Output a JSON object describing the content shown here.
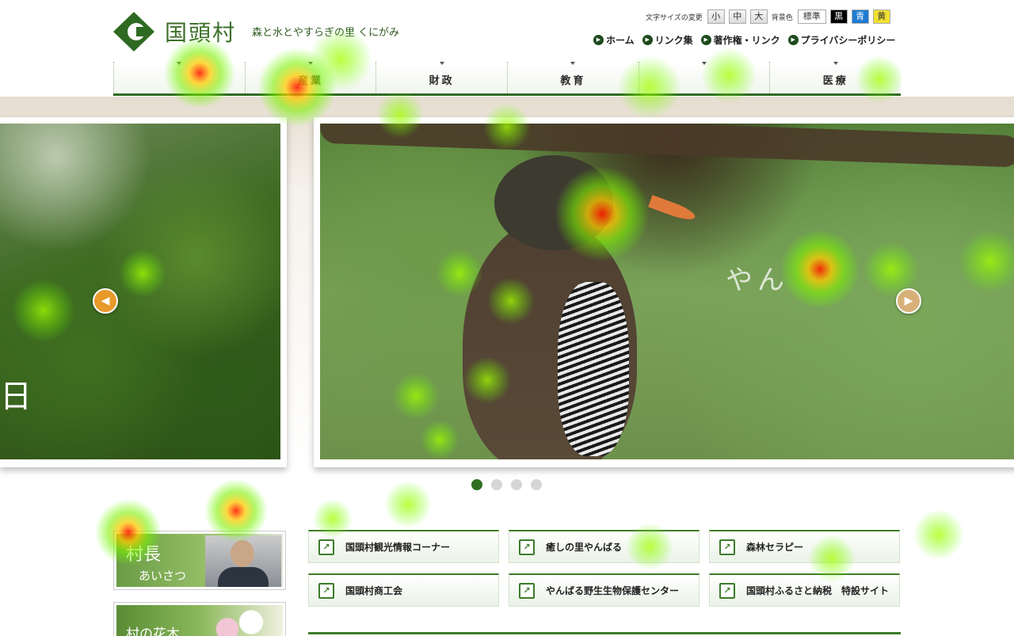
{
  "header": {
    "logo_title": "国頭村",
    "tagline": "森と水とやすらぎの里 くにがみ",
    "font_size_label": "文字サイズの変更",
    "font_sizes": [
      "小",
      "中",
      "大"
    ],
    "bg_color_label": "背景色",
    "bg_colors": [
      "標準",
      "黒",
      "青",
      "黄"
    ],
    "links": [
      "ホーム",
      "リンク集",
      "著作権・リンク",
      "プライバシーポリシー"
    ]
  },
  "global_nav": [
    "",
    "産業",
    "財政",
    "教育",
    "",
    "医療"
  ],
  "slider": {
    "left_caption_1": "日",
    "left_caption_2": "",
    "main_caption": "やん",
    "pages": 4,
    "active_page": 1
  },
  "side_banners": {
    "mayor_title": "村長",
    "mayor_sub": "あいさつ",
    "flower_title": "村の花木"
  },
  "quick_links": [
    "国頭村観光情報コーナー",
    "癒しの里やんばる",
    "森林セラピー",
    "国頭村商工会",
    "やんばる野生生物保護センター",
    "国頭村ふるさと納税　特設サイト"
  ],
  "icons": {
    "logo": "kunigami-logo-icon",
    "nav_dot": "arrow-circle-icon",
    "external": "external-link-icon",
    "prev": "chevron-left-icon",
    "next": "chevron-right-icon"
  },
  "colors": {
    "brand_green": "#2e6a22",
    "accent_orange": "#e89a2a"
  }
}
